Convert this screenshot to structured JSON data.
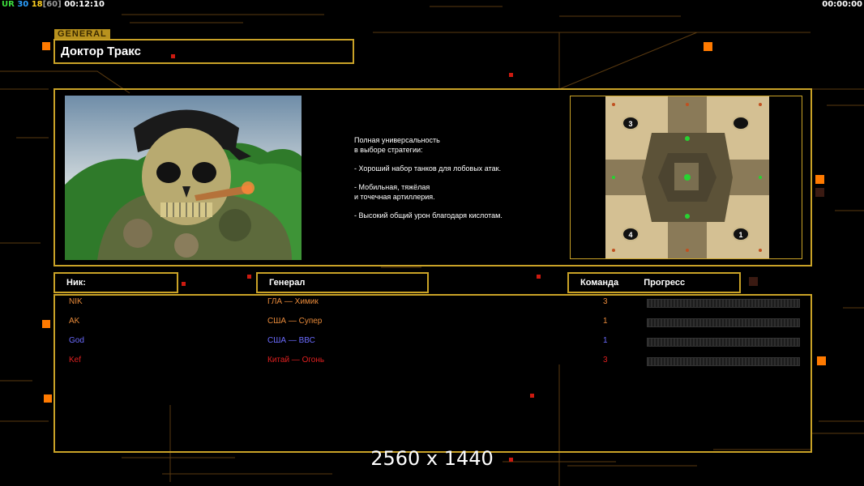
{
  "hud": {
    "ur_label": "UR",
    "fps_value": "30",
    "fps_value2": "18",
    "fps_bracket": "[60]",
    "elapsed": "00:12:10",
    "timer": "00:00:00"
  },
  "general": {
    "tag": "GENERAL",
    "name": "Доктор Тракс",
    "description": [
      "Полная универсальность",
      "в выборе стратегии:",
      "",
      "- Хороший набор танков для лобовых атак.",
      "",
      "- Мобильная, тяжёлая",
      "и точечная артиллерия.",
      "",
      "- Высокий общий урон благодаря кислотам."
    ]
  },
  "map": {
    "start_positions": [
      "3",
      "",
      "4",
      "1"
    ]
  },
  "table": {
    "headers": {
      "nick": "Ник:",
      "general": "Генерал",
      "team": "Команда",
      "progress": "Прогресс"
    },
    "rows": [
      {
        "nick": "NIK",
        "general": "ГЛА — Химик",
        "team": "3",
        "color": "#e88a3a",
        "progress": 0
      },
      {
        "nick": "AK",
        "general": "США — Супер",
        "team": "1",
        "color": "#e88a3a",
        "progress": 0
      },
      {
        "nick": "God",
        "general": "США — ВВС",
        "team": "1",
        "color": "#6b6bff",
        "progress": 0
      },
      {
        "nick": "Kef",
        "general": "Китай — Огонь",
        "team": "3",
        "color": "#e02020",
        "progress": 0
      }
    ]
  },
  "overlay": {
    "resolution": "2560 x 1440"
  },
  "colors": {
    "frame": "#c9a227",
    "accent_orange": "#ff7a00",
    "accent_red": "#cc1a10"
  }
}
